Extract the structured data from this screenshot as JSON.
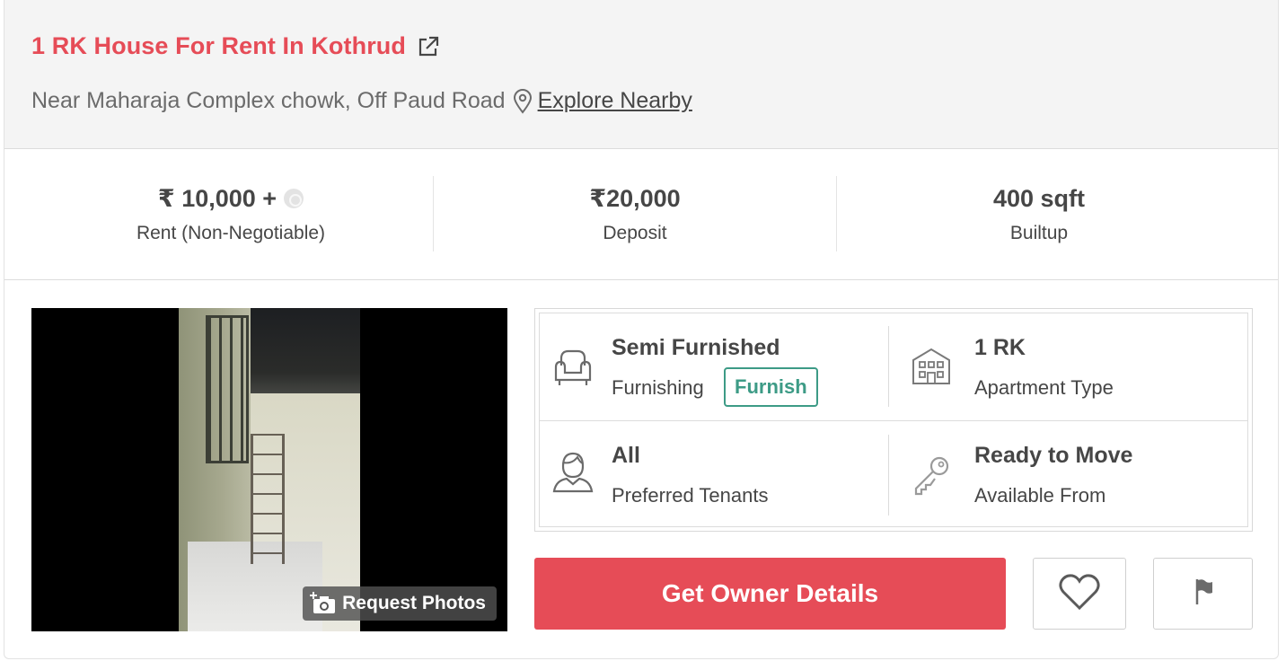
{
  "listing": {
    "title": "1 RK House For Rent In Kothrud",
    "address": "Near Maharaja Complex chowk, Off Paud Road",
    "explore_label": "Explore Nearby"
  },
  "stats": [
    {
      "value": "₹ 10,000 +",
      "label": "Rent (Non-Negotiable)"
    },
    {
      "value": "₹20,000",
      "label": "Deposit"
    },
    {
      "value": "400 sqft",
      "label": "Builtup"
    }
  ],
  "photo": {
    "request_label": "Request Photos"
  },
  "details": {
    "furnishing": {
      "title": "Semi Furnished",
      "label": "Furnishing",
      "action": "Furnish",
      "icon": "sofa-icon"
    },
    "apartment": {
      "title": "1 RK",
      "label": "Apartment Type",
      "icon": "building-icon"
    },
    "tenants": {
      "title": "All",
      "label": "Preferred Tenants",
      "icon": "person-icon"
    },
    "availability": {
      "title": "Ready to Move",
      "label": "Available From",
      "icon": "key-icon"
    }
  },
  "actions": {
    "owner_label": "Get Owner Details",
    "shortlist_icon": "heart-icon",
    "report_icon": "flag-icon"
  },
  "colors": {
    "accent": "#e64c57",
    "furnish_green": "#3d9b86",
    "header_bg": "#f4f4f4"
  }
}
